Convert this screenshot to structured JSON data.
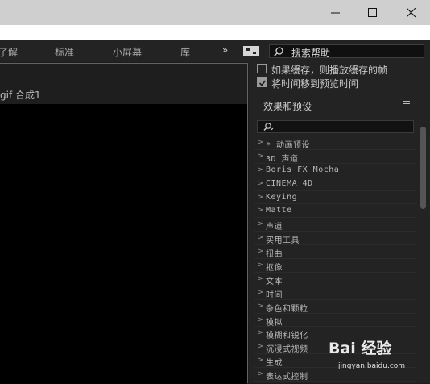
{
  "window": {
    "minimize_icon": "minimize-icon",
    "maximize_icon": "maximize-icon",
    "close_icon": "close-icon"
  },
  "toolbar": {
    "workspaces": [
      "了解",
      "标准",
      "小屏幕",
      "库"
    ],
    "more": "»",
    "search_help_placeholder": "搜索帮助"
  },
  "composition": {
    "tab_label": "gif 合成1"
  },
  "options": [
    {
      "label": "如果缓存，则播放缓存的帧",
      "checked": false
    },
    {
      "label": "将时间移到预览时间",
      "checked": true
    }
  ],
  "effects": {
    "title": "效果和预设",
    "search_value": "",
    "items": [
      "* 动画预设",
      "3D 声道",
      "Boris FX Mocha",
      "CINEMA 4D",
      "Keying",
      "Matte",
      "声道",
      "实用工具",
      "扭曲",
      "抠像",
      "文本",
      "时间",
      "杂色和颗粒",
      "模拟",
      "模糊和锐化",
      "沉浸式视频",
      "生成",
      "表达式控制"
    ]
  },
  "watermark": {
    "logo": "Bai 经验",
    "url": "jingyan.baidu.com"
  }
}
